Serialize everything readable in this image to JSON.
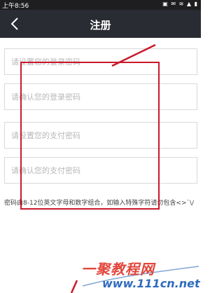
{
  "status_bar": {
    "time": "上午8:56",
    "icons": "▣ ✉ ≋ ▲ ▮"
  },
  "app_bar": {
    "title": "注册",
    "back_icon": "chevron-left-icon"
  },
  "fields": [
    {
      "placeholder": "请设置您的登录密码",
      "value": ""
    },
    {
      "placeholder": "请确认您的登录密码",
      "value": ""
    },
    {
      "placeholder": "请设置您的支付密码",
      "value": ""
    },
    {
      "placeholder": "请确认您的支付密码",
      "value": ""
    }
  ],
  "hint": "密码由8-12位英文字母和数字组合，如输入特殊字符请勿包含<>`\\/",
  "watermark": {
    "line1": "一聚教程网",
    "line2": "www.111cn.net"
  },
  "colors": {
    "status_bar": "#1e1e20",
    "app_bar": "#2a2c33",
    "annotation": "#c9192b",
    "watermark_red": "#e2463c",
    "watermark_blue": "#2f6bbd"
  }
}
